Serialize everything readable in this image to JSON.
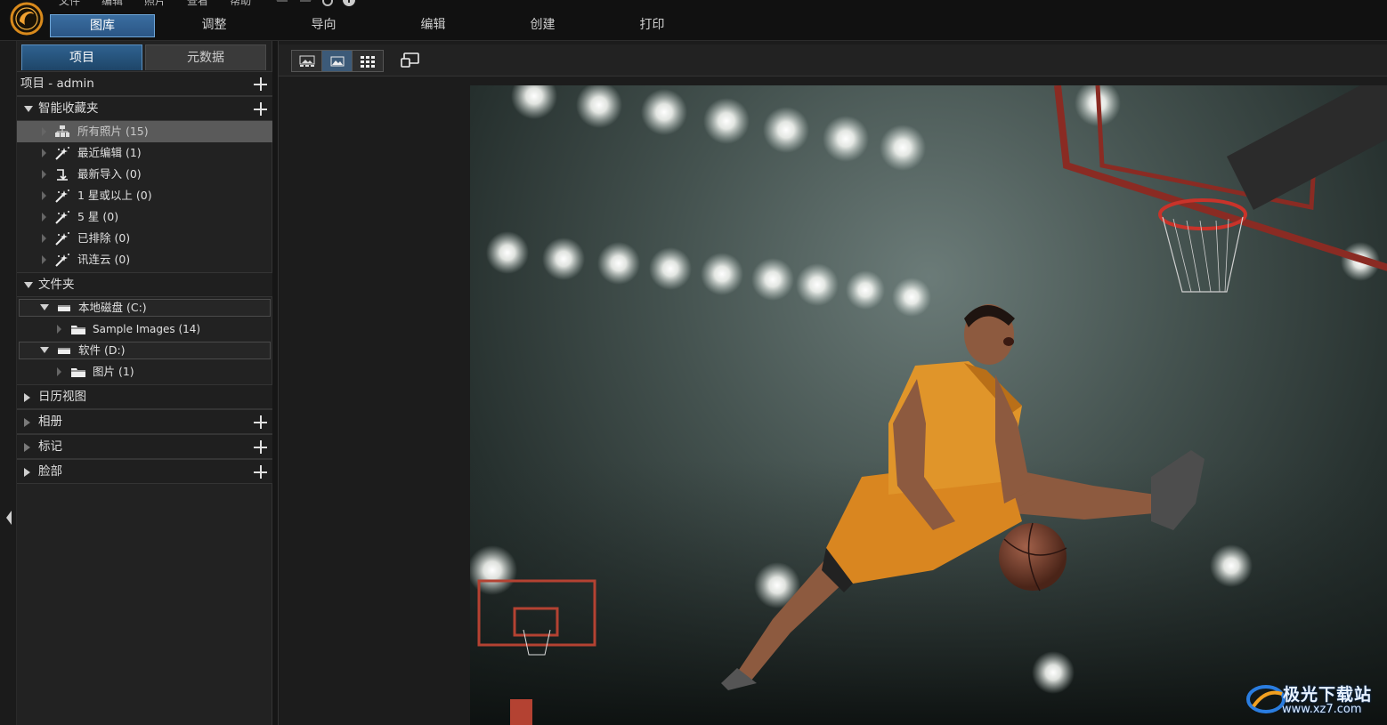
{
  "menu": [
    "文件",
    "编辑",
    "照片",
    "查看",
    "帮助"
  ],
  "mode_tabs": [
    "图库",
    "调整",
    "导向",
    "编辑",
    "创建",
    "打印"
  ],
  "panel_tabs": [
    "项目",
    "元数据"
  ],
  "project": {
    "label": "项目 - admin"
  },
  "smart_collections": {
    "title": "智能收藏夹",
    "items": [
      {
        "label": "所有照片 (15)",
        "icon": "photo-stack-icon"
      },
      {
        "label": "最近编辑 (1)",
        "icon": "magic-wand-icon"
      },
      {
        "label": "最新导入 (0)",
        "icon": "import-arrow-icon"
      },
      {
        "label": "1 星或以上 (0)",
        "icon": "magic-wand-icon"
      },
      {
        "label": "5 星 (0)",
        "icon": "magic-wand-icon"
      },
      {
        "label": "已排除 (0)",
        "icon": "magic-wand-icon"
      },
      {
        "label": "讯连云 (0)",
        "icon": "magic-wand-icon"
      }
    ]
  },
  "folders": {
    "title": "文件夹",
    "drives": [
      {
        "label": "本地磁盘 (C:)",
        "children": [
          {
            "label": "Sample Images (14)"
          }
        ]
      },
      {
        "label": "软件 (D:)",
        "children": [
          {
            "label": "图片 (1)"
          }
        ]
      }
    ]
  },
  "sections": [
    {
      "label": "日历视图",
      "has_add": false
    },
    {
      "label": "相册",
      "has_add": true
    },
    {
      "label": "标记",
      "has_add": true
    },
    {
      "label": "脸部",
      "has_add": true
    }
  ],
  "watermark": {
    "text": "极光下载站",
    "url": "www.xz7.com"
  },
  "colors": {
    "accent": "#3a6ea0",
    "jersey": "#e0952a"
  }
}
